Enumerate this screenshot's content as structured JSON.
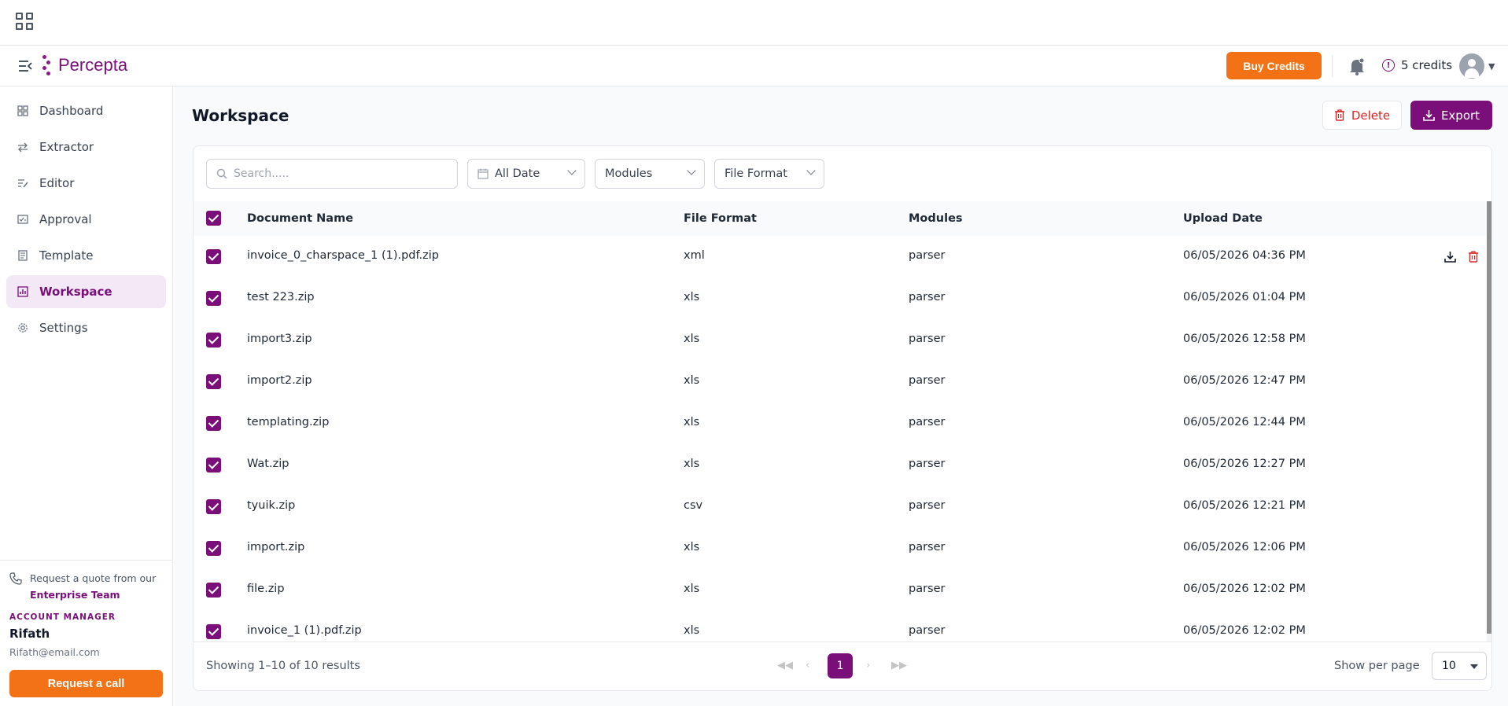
{
  "app": {
    "logo_text": "Percepta"
  },
  "header": {
    "buy_credits_label": "Buy Credits",
    "credits_text": "5 credits"
  },
  "sidebar": {
    "items": [
      {
        "label": "Dashboard",
        "icon": "dashboard-icon"
      },
      {
        "label": "Extractor",
        "icon": "extractor-icon"
      },
      {
        "label": "Editor",
        "icon": "editor-icon"
      },
      {
        "label": "Approval",
        "icon": "approval-icon"
      },
      {
        "label": "Template",
        "icon": "template-icon"
      },
      {
        "label": "Workspace",
        "icon": "workspace-icon",
        "active": true
      },
      {
        "label": "Settings",
        "icon": "gear-icon"
      }
    ],
    "quote_text": "Request a quote from our",
    "enterprise_link": "Enterprise Team",
    "account_manager_label": "ACCOUNT MANAGER",
    "manager_name": "Rifath",
    "manager_email": "Rifath@email.com",
    "request_call_label": "Request a call"
  },
  "main": {
    "title": "Workspace",
    "delete_label": "Delete",
    "export_label": "Export",
    "search_placeholder": "Search.....",
    "filters": {
      "date": "All Date",
      "modules": "Modules",
      "file_format": "File Format"
    },
    "columns": [
      "Document Name",
      "File Format",
      "Modules",
      "Upload Date"
    ],
    "rows": [
      {
        "name": "invoice_0_charspace_1 (1).pdf.zip",
        "format": "xml",
        "module": "parser",
        "date": "06/05/2026 04:36 PM"
      },
      {
        "name": "test 223.zip",
        "format": "xls",
        "module": "parser",
        "date": "06/05/2026 01:04 PM"
      },
      {
        "name": "import3.zip",
        "format": "xls",
        "module": "parser",
        "date": "06/05/2026 12:58 PM"
      },
      {
        "name": "import2.zip",
        "format": "xls",
        "module": "parser",
        "date": "06/05/2026 12:47 PM"
      },
      {
        "name": "templating.zip",
        "format": "xls",
        "module": "parser",
        "date": "06/05/2026 12:44 PM"
      },
      {
        "name": "Wat.zip",
        "format": "xls",
        "module": "parser",
        "date": "06/05/2026 12:27 PM"
      },
      {
        "name": "tyuik.zip",
        "format": "csv",
        "module": "parser",
        "date": "06/05/2026 12:21 PM"
      },
      {
        "name": "import.zip",
        "format": "xls",
        "module": "parser",
        "date": "06/05/2026 12:06 PM"
      },
      {
        "name": "file.zip",
        "format": "xls",
        "module": "parser",
        "date": "06/05/2026 12:02 PM"
      },
      {
        "name": "invoice_1 (1).pdf.zip",
        "format": "xls",
        "module": "parser",
        "date": "06/05/2026 12:02 PM"
      }
    ],
    "showing_text": "Showing 1–10 of 10 results",
    "current_page": "1",
    "show_per_page_label": "Show per page",
    "per_page_value": "10"
  },
  "colors": {
    "brand": "#7a0f7a",
    "accent": "#f47216",
    "danger": "#dc2626"
  }
}
